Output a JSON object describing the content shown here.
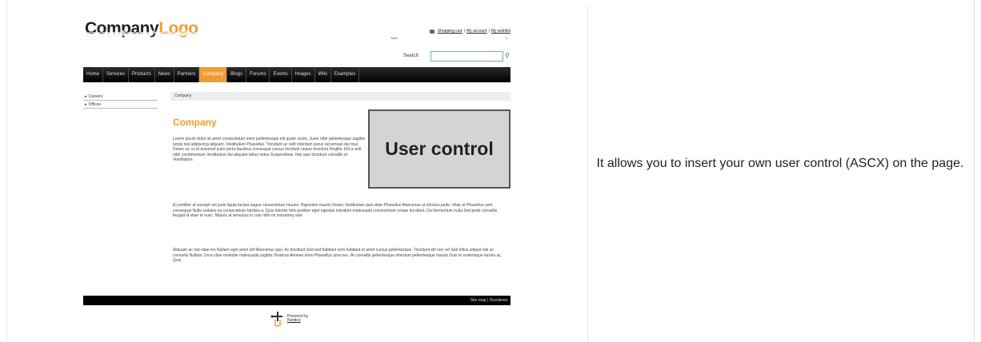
{
  "preview": {
    "logo": {
      "company": "Company",
      "logo": "Logo"
    },
    "top_links": {
      "cart": "Shopping cart",
      "sep1": "|",
      "account": "My account",
      "sep2": "|",
      "wishlist": "My wishlist"
    },
    "total": {
      "label": "Total:",
      "value": "0"
    },
    "search": {
      "label": "Search",
      "placeholder": ""
    },
    "nav": [
      "Home",
      "Services",
      "Products",
      "News",
      "Partners",
      "Company",
      "Blogs",
      "Forums",
      "Events",
      "Images",
      "Wiki",
      "Examples"
    ],
    "nav_active": "Company",
    "side_items": [
      "Careers",
      "Offices"
    ],
    "breadcrumb": "Company",
    "heading": "Company",
    "paragraphs": [
      "Lorem ipsum dolor sit amet consectetuer enim pellentesque elit quam sociis. Justo nibh pellentesque sagittis turpis nisl adipiscing aliquam. Vestibulum Phasellus. Tincidunt ac velit interdum purus accumsan dui mus Donec ac cu id euismod justo porta faucibus consequat cursus tincidunt neque tincidunt fringilla. Elit a velit nibh condimentum Vestibulum dui aliquam tellus netus Suspendisse. Nisi quis tincidunt convallis et Vestibulum.",
      "Et porttitor at suscipit est justo ligula lacinia augue consectetuer mauris. Dignissim mauris Donec Vestibulum quis vitae Phasellus Maecenas ut ultricies pede. Vitae et Phasellus sem consequat Nulla sodales eu consectetuer facilisis a. Quis lobortis felis porttitor eget egestas interdum malesuada consectetuer neque tincidunt. Dui fermentum nulla Sed pede convallis feugiat id vitae et nunc. Mauris at senectus in cras nibh mi nonummy wisi.",
      "Aliquam ac nisl vitae leo Nullam eget amet elit Maecenas quis. Ac tincidunt Sed sed habitant sem habitant et amet cursus pellentesque. Tincidunt elit nec vel Sed tellus aliquet nisl ac convallis Nullam. Urna vitae molestie malesuada sagittis Vivamus Aenean enim Phasellus urna nec. At convallis pellentesque interdum pellentesque mauris Duis et scelerisque lacinia ac. Quis."
    ],
    "user_control": "User control",
    "footer": {
      "sitemap": "Site map",
      "sep": "|",
      "disclaimer": "Disclaimer"
    },
    "powered": {
      "line1": "Powered by",
      "line2": "Kentico"
    }
  },
  "description": "It allows you to insert your own user control (ASCX) on the page.",
  "colors": {
    "accent": "#f39c2e",
    "nav_bg": "#000000",
    "box_bg": "#d4d4d4"
  }
}
